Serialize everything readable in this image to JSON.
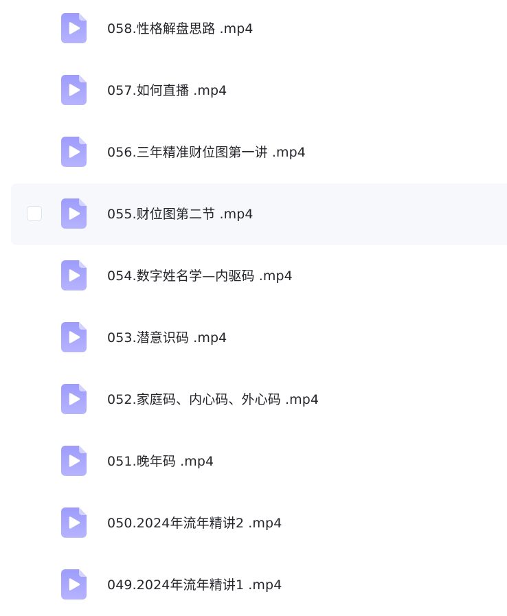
{
  "files": [
    {
      "name": "058.性格解盘思路 .mp4",
      "icon": "video-file-icon"
    },
    {
      "name": "057.如何直播 .mp4",
      "icon": "video-file-icon"
    },
    {
      "name": "056.三年精准财位图第一讲 .mp4",
      "icon": "video-file-icon"
    },
    {
      "name": "055.财位图第二节 .mp4",
      "icon": "video-file-icon",
      "hovered": true
    },
    {
      "name": "054.数字姓名学—内驱码 .mp4",
      "icon": "video-file-icon"
    },
    {
      "name": "053.潜意识码 .mp4",
      "icon": "video-file-icon"
    },
    {
      "name": "052.家庭码、内心码、外心码 .mp4",
      "icon": "video-file-icon"
    },
    {
      "name": "051.晚年码 .mp4",
      "icon": "video-file-icon"
    },
    {
      "name": "050.2024年流年精讲2 .mp4",
      "icon": "video-file-icon"
    },
    {
      "name": "049.2024年流年精讲1 .mp4",
      "icon": "video-file-icon"
    }
  ],
  "colors": {
    "icon_top": "#9d9cfb",
    "icon_bottom": "#b6b3ff",
    "icon_fold": "#d4d2ff",
    "play": "#ffffff",
    "text": "#25262b",
    "hover_bg": "#f7f8fc"
  }
}
